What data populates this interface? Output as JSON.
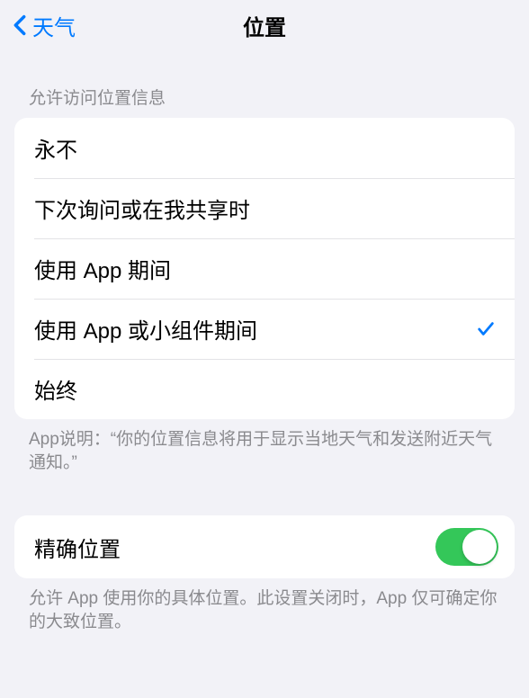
{
  "nav": {
    "back_label": "天气",
    "title": "位置"
  },
  "section1": {
    "header": "允许访问位置信息",
    "options": [
      {
        "label": "永不",
        "selected": false
      },
      {
        "label": "下次询问或在我共享时",
        "selected": false
      },
      {
        "label": "使用 App 期间",
        "selected": false
      },
      {
        "label": "使用 App 或小组件期间",
        "selected": true
      },
      {
        "label": "始终",
        "selected": false
      }
    ],
    "footer": "App说明：“你的位置信息将用于显示当地天气和发送附近天气通知。”"
  },
  "section2": {
    "precise_label": "精确位置",
    "precise_enabled": true,
    "footer": "允许 App 使用你的具体位置。此设置关闭时，App 仅可确定你的大致位置。"
  },
  "colors": {
    "tint": "#007aff",
    "toggle_on": "#34c759"
  }
}
